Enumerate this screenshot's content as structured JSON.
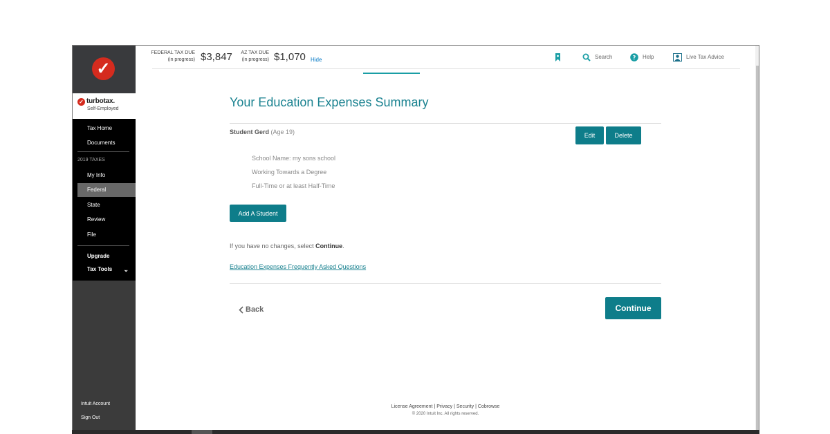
{
  "brand": {
    "name": "turbotax.",
    "sub": "Self-Employed"
  },
  "sidebar": {
    "items_top": [
      {
        "label": "Tax Home"
      },
      {
        "label": "Documents"
      }
    ],
    "section_label": "2019 TAXES",
    "items_taxes": [
      {
        "label": "My Info"
      },
      {
        "label": "Federal",
        "active": true
      },
      {
        "label": "State"
      },
      {
        "label": "Review"
      },
      {
        "label": "File"
      }
    ],
    "upgrade": "Upgrade",
    "tax_tools": "Tax Tools",
    "footer": {
      "account": "Intuit Account",
      "signout": "Sign Out"
    }
  },
  "header": {
    "federal_label_1": "FEDERAL TAX DUE",
    "federal_label_2": "(in progress)",
    "federal_amount": "$3,847",
    "state_label_1": "AZ TAX DUE",
    "state_label_2": "(in progress)",
    "state_amount": "$1,070",
    "hide": "Hide",
    "search": "Search",
    "help": "Help",
    "live_advice": "Live Tax Advice"
  },
  "main": {
    "title": "Your Education Expenses Summary",
    "student": {
      "name": "Student Gerd",
      "age": "(Age 19)",
      "details": [
        "School Name: my sons school",
        "Working Towards a Degree",
        "Full-Time or at least Half-Time"
      ]
    },
    "edit": "Edit",
    "delete": "Delete",
    "add_student": "Add A Student",
    "note_prefix": "If you have no changes, select ",
    "note_bold": "Continue",
    "note_suffix": ".",
    "faq": "Education Expenses Frequently Asked Questions",
    "back": "Back",
    "continue": "Continue"
  },
  "footer": {
    "license": "License Agreement",
    "privacy": "Privacy",
    "security": "Security",
    "cobrowse": "Cobrowse",
    "copyright": "© 2020 Intuit Inc. All rights reserved."
  },
  "colors": {
    "accent": "#0e7d8a",
    "title": "#1a8290",
    "brand_red": "#d52b1e",
    "sidebar_dark": "#3b3b3b",
    "nav_black": "#000000"
  }
}
